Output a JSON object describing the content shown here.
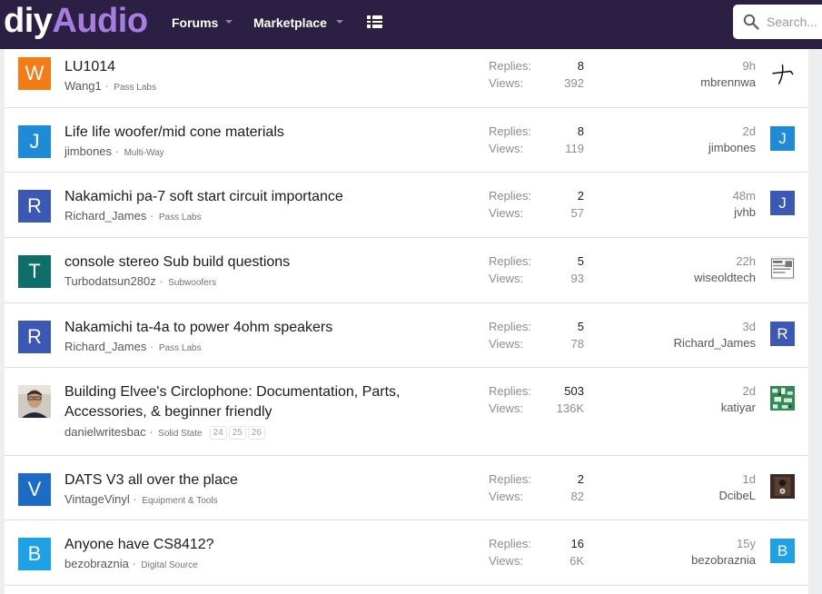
{
  "site": {
    "logo_a": "diy",
    "logo_b": "Audio"
  },
  "nav": {
    "forums": "Forums",
    "marketplace": "Marketplace",
    "search_placeholder": "Search..."
  },
  "threads": [
    {
      "avatar": "W",
      "avatar_color": "#f47c17",
      "title": "LU1014",
      "author": "Wang1",
      "forum": "Pass Labs",
      "replies_label": "Replies:",
      "replies": "8",
      "views_label": "Views:",
      "views": "392",
      "time": "9h",
      "last_user": "mbrennwa",
      "last_avatar": "",
      "last_avatar_kind": "drawing"
    },
    {
      "avatar": "J",
      "avatar_color": "#1f8ad6",
      "title": "Life life woofer/mid cone materials",
      "author": "jimbones",
      "forum": "Multi-Way",
      "replies_label": "Replies:",
      "replies": "8",
      "views_label": "Views:",
      "views": "119",
      "time": "2d",
      "last_user": "jimbones",
      "last_avatar": "J",
      "last_avatar_color": "#1f8ad6"
    },
    {
      "avatar": "R",
      "avatar_color": "#3b58b5",
      "title": "Nakamichi pa-7 soft start circuit importance",
      "author": "Richard_James",
      "forum": "Pass Labs",
      "replies_label": "Replies:",
      "replies": "2",
      "views_label": "Views:",
      "views": "57",
      "time": "48m",
      "last_user": "jvhb",
      "last_avatar": "J",
      "last_avatar_color": "#3b58b5"
    },
    {
      "avatar": "T",
      "avatar_color": "#0f6e6a",
      "title": "console stereo Sub build questions",
      "author": "Turbodatsun280z",
      "forum": "Subwoofers",
      "replies_label": "Replies:",
      "replies": "5",
      "views_label": "Views:",
      "views": "93",
      "time": "22h",
      "last_user": "wiseoldtech",
      "last_avatar": "",
      "last_avatar_kind": "document"
    },
    {
      "avatar": "R",
      "avatar_color": "#3b58b5",
      "title": "Nakamichi ta-4a to power 4ohm speakers",
      "author": "Richard_James",
      "forum": "Pass Labs",
      "replies_label": "Replies:",
      "replies": "5",
      "views_label": "Views:",
      "views": "78",
      "time": "3d",
      "last_user": "Richard_James",
      "last_avatar": "R",
      "last_avatar_color": "#3b58b5"
    },
    {
      "avatar": "",
      "avatar_kind": "photo",
      "title": "Building Elvee's Circlophone: Documentation, Parts, Accessories, & beginner friendly",
      "author": "danielwritesbac",
      "forum": "Solid State",
      "pages": [
        "24",
        "25",
        "26"
      ],
      "replies_label": "Replies:",
      "replies": "503",
      "views_label": "Views:",
      "views": "136K",
      "time": "2d",
      "last_user": "katiyar",
      "last_avatar": "",
      "last_avatar_kind": "pcb"
    },
    {
      "avatar": "V",
      "avatar_color": "#1c6bc4",
      "title": "DATS V3 all over the place",
      "author": "VintageVinyl",
      "forum": "Equipment & Tools",
      "replies_label": "Replies:",
      "replies": "2",
      "views_label": "Views:",
      "views": "82",
      "time": "1d",
      "last_user": "DcibeL",
      "last_avatar": "",
      "last_avatar_kind": "speaker"
    },
    {
      "avatar": "B",
      "avatar_color": "#1ea1e6",
      "title": "Anyone have CS8412?",
      "author": "bezobraznia",
      "forum": "Digital Source",
      "replies_label": "Replies:",
      "replies": "16",
      "views_label": "Views:",
      "views": "6K",
      "time": "15y",
      "last_user": "bezobraznia",
      "last_avatar": "B",
      "last_avatar_color": "#1ea1e6"
    }
  ]
}
